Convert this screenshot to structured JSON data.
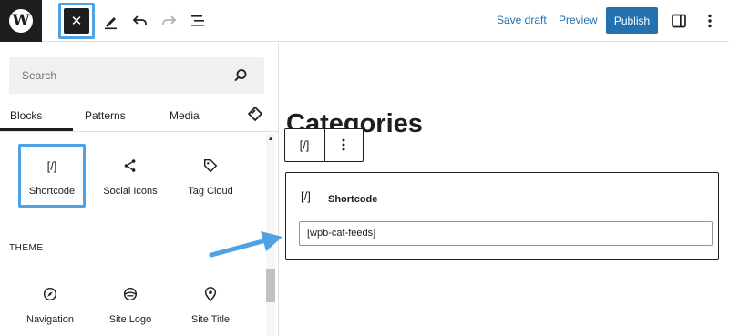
{
  "topbar": {
    "logo_letter": "W",
    "close_symbol": "✕",
    "save_draft": "Save draft",
    "preview": "Preview",
    "publish": "Publish"
  },
  "inserter": {
    "search_placeholder": "Search",
    "tabs": [
      {
        "label": "Blocks",
        "active": true
      },
      {
        "label": "Patterns",
        "active": false
      },
      {
        "label": "Media",
        "active": false
      }
    ],
    "blocks": [
      {
        "label": "Shortcode",
        "glyph": "[/]",
        "icon": "shortcode-icon"
      },
      {
        "label": "Social Icons",
        "glyph": "",
        "icon": "share-icon"
      },
      {
        "label": "Tag Cloud",
        "glyph": "",
        "icon": "tag-icon"
      }
    ],
    "section_theme": "THEME",
    "theme_blocks": [
      {
        "label": "Navigation",
        "icon": "compass-icon"
      },
      {
        "label": "Site Logo",
        "icon": "site-logo-icon"
      },
      {
        "label": "Site Title",
        "icon": "map-pin-icon"
      }
    ]
  },
  "editor": {
    "heading": "Categories",
    "toolbar_glyph": "[/]",
    "block_title": "Shortcode",
    "block_glyph": "[/]",
    "shortcode_value": "[wpb-cat-feeds]"
  },
  "colors": {
    "accent": "#2271b1",
    "highlight": "#4ea3e6",
    "dark": "#1e1e1e"
  }
}
